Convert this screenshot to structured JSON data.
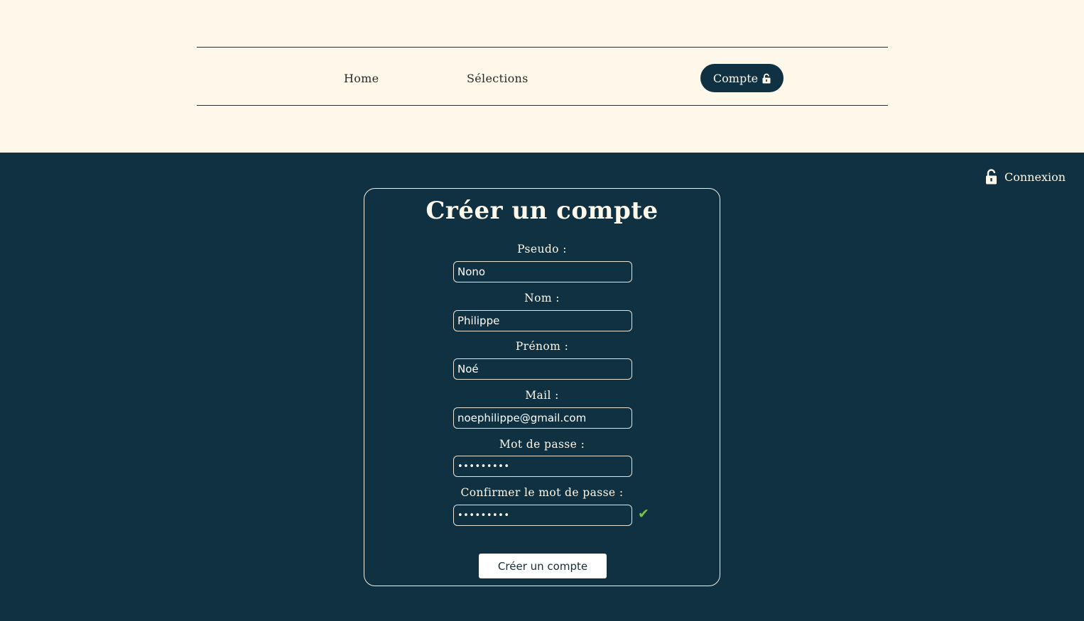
{
  "nav": {
    "home_label": "Home",
    "selections_label": "Sélections",
    "account_label": "Compte",
    "account_icon": "lock-open-icon"
  },
  "login": {
    "label": "Connexion",
    "icon": "lock-open-icon"
  },
  "form": {
    "title": "Créer un compte",
    "fields": [
      {
        "label": "Pseudo :",
        "value": "Nono",
        "type": "text"
      },
      {
        "label": "Nom :",
        "value": "Philippe",
        "type": "text"
      },
      {
        "label": "Prénom :",
        "value": "Noé",
        "type": "text"
      },
      {
        "label": "Mail :",
        "value": "noephilippe@gmail.com",
        "type": "email"
      },
      {
        "label": "Mot de passe :",
        "value": "•••••••••",
        "type": "password"
      },
      {
        "label": "Confirmer le mot de passe :",
        "value": "•••••••••",
        "type": "password"
      }
    ],
    "confirm_check_glyph": "✔",
    "submit_label": "Créer un compte"
  },
  "colors": {
    "page_background": "#0f3142",
    "header_background": "#fdf8ea",
    "check_color": "#7bc242"
  }
}
